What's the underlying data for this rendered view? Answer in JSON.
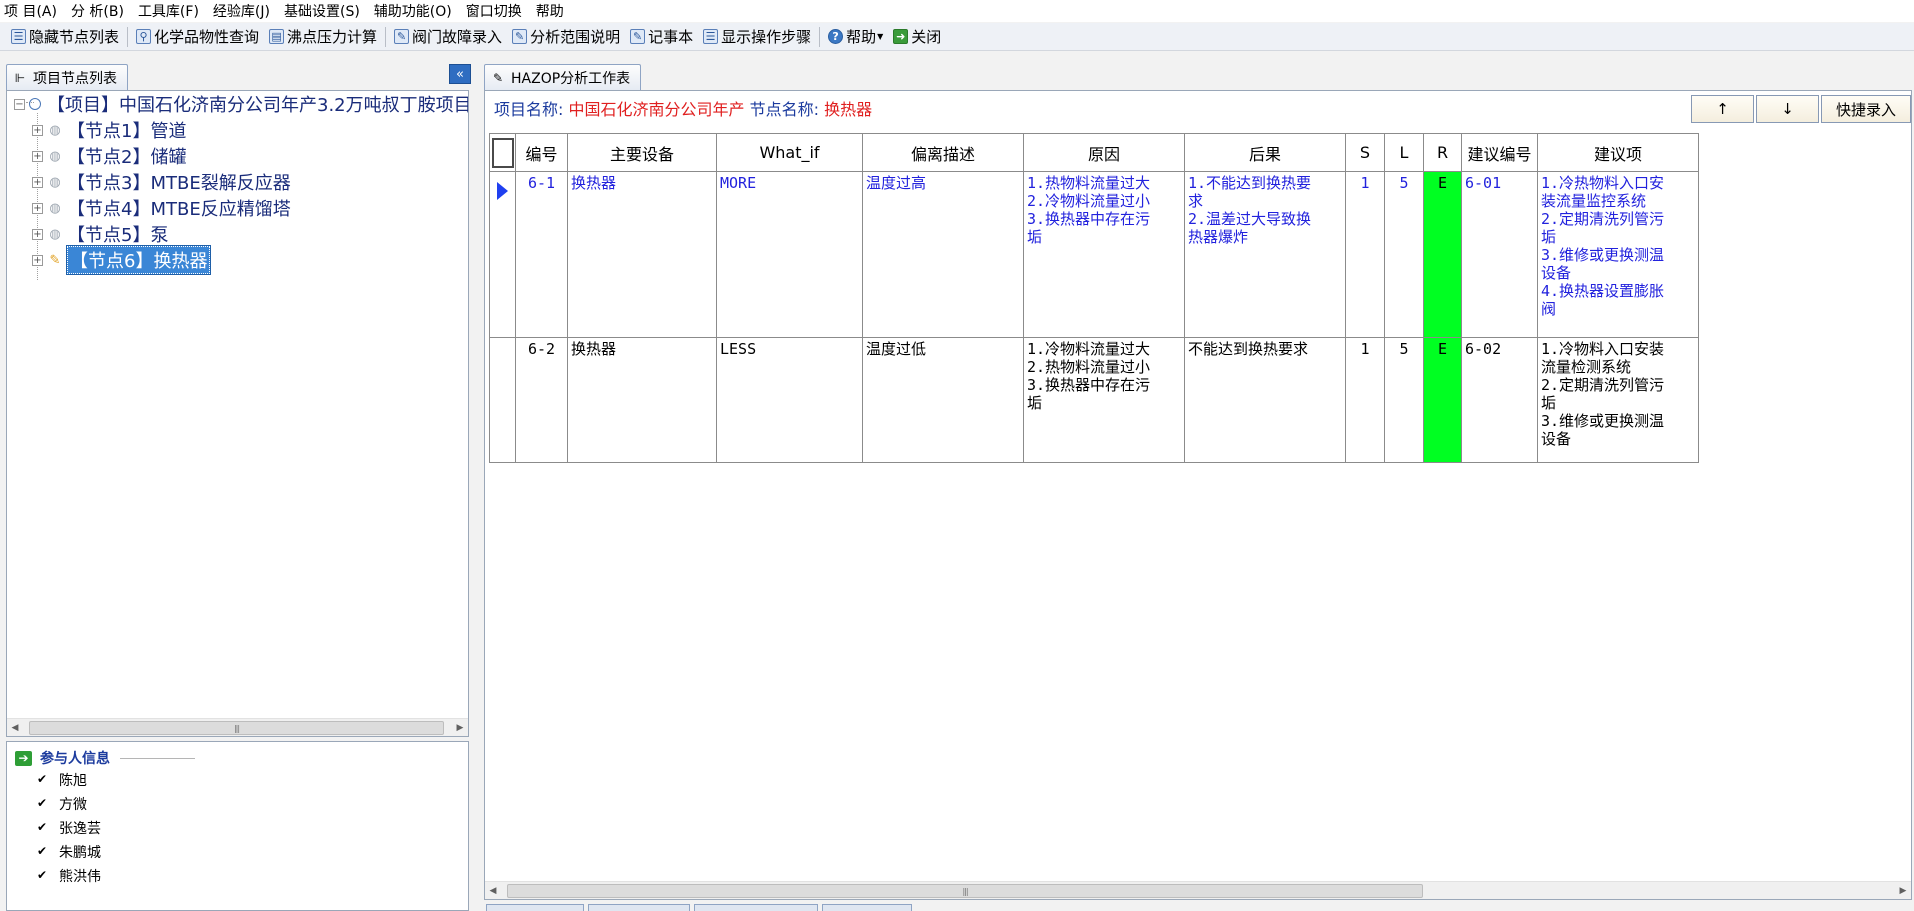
{
  "menu": [
    "项 目(A)",
    "分 析(B)",
    "工具库(F)",
    "经验库(J)",
    "基础设置(S)",
    "辅助功能(O)",
    "窗口切换",
    "帮助"
  ],
  "toolbar": {
    "hide_nodes": "隐藏节点列表",
    "chem_query": "化学品物性查询",
    "boiling_calc": "沸点压力计算",
    "valve_fault": "阀门故障录入",
    "scope_desc": "分析范围说明",
    "notepad": "记事本",
    "show_steps": "显示操作步骤",
    "help": "帮助",
    "close": "关闭"
  },
  "left": {
    "tab_label": "项目节点列表",
    "root_label": "【项目】中国石化济南分公司年产3.2万吨叔丁胺项目",
    "nodes": [
      {
        "label": "【节点1】管道"
      },
      {
        "label": "【节点2】储罐"
      },
      {
        "label": "【节点3】MTBE裂解反应器"
      },
      {
        "label": "【节点4】MTBE反应精馏塔"
      },
      {
        "label": "【节点5】泵"
      },
      {
        "label": "【节点6】换热器"
      }
    ],
    "participants_title": "参与人信息",
    "participants": [
      {
        "name": "陈旭",
        "checked": true
      },
      {
        "name": "方微",
        "checked": true
      },
      {
        "name": "张逸芸",
        "checked": true
      },
      {
        "name": "朱鹏城",
        "checked": true
      },
      {
        "name": "熊洪伟",
        "checked": true
      }
    ]
  },
  "right": {
    "tab_label": "HAZOP分析工作表",
    "project_label": "项目名称:",
    "project_value": "中国石化济南分公司年产",
    "node_label": "节点名称:",
    "node_value": "换热器",
    "btn_up": "↑",
    "btn_down": "↓",
    "btn_quick": "快捷录入",
    "columns": [
      "编号",
      "主要设备",
      "What_if",
      "偏离描述",
      "原因",
      "后果",
      "S",
      "L",
      "R",
      "建议编号",
      "建议项"
    ],
    "rows": [
      {
        "id": "6-1",
        "equipment": "换热器",
        "what_if": "MORE",
        "deviation": "温度过高",
        "causes": [
          "1.热物料流量过大",
          "2.冷物料流量过小",
          "3.换热器中存在污",
          "垢"
        ],
        "consequences": [
          "1.不能达到换热要",
          "求",
          "2.温差过大导致换",
          "热器爆炸"
        ],
        "s": "1",
        "l": "5",
        "r": "E",
        "suggest_id": "6-01",
        "suggestions": [
          "1.冷热物料入口安",
          "装流量监控系统",
          "2.定期清洗列管污",
          "垢",
          "3.维修或更换测温",
          "设备",
          "4.换热器设置膨胀",
          "阀"
        ]
      },
      {
        "id": "6-2",
        "equipment": "换热器",
        "what_if": "LESS",
        "deviation": "温度过低",
        "causes": [
          "1.冷物料流量过大",
          "2.热物料流量过小",
          "3.换热器中存在污",
          "垢"
        ],
        "consequences": [
          "不能达到换热要求"
        ],
        "s": "1",
        "l": "5",
        "r": "E",
        "suggest_id": "6-02",
        "suggestions": [
          "1.冷物料入口安装",
          "流量检测系统",
          "2.定期清洗列管污",
          "垢",
          "3.维修或更换测温",
          "设备"
        ]
      }
    ]
  },
  "colors": {
    "risk_E": "#00ff22",
    "selected_row_text": "#2222dd",
    "info_value": "#e02020"
  }
}
